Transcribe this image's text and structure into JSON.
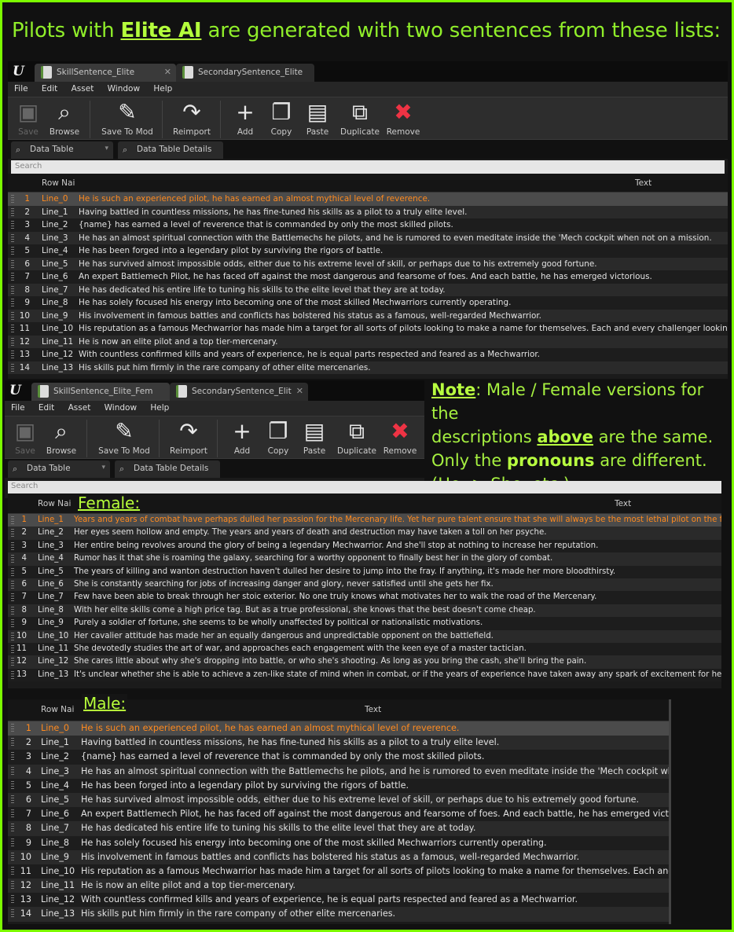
{
  "headline": {
    "pre": "Pilots with ",
    "emph": "Elite AI",
    "post": " are generated with two sentences from these lists:"
  },
  "editor1": {
    "tabs": [
      "SkillSentence_Elite",
      "SecondarySentence_Elite"
    ],
    "menu": [
      "File",
      "Edit",
      "Asset",
      "Window",
      "Help"
    ],
    "tools": [
      "Save",
      "Browse",
      "Save To Mod",
      "Reimport",
      "Add",
      "Copy",
      "Paste",
      "Duplicate",
      "Remove"
    ],
    "panel_tabs": [
      "Data Table",
      "Data Table Details"
    ],
    "search_placeholder": "Search",
    "col_row": "Row Nai",
    "col_text": "Text",
    "rows": [
      {
        "n": "1",
        "name": "Line_0",
        "text": "He is such an experienced pilot, he has earned an almost mythical level of reverence."
      },
      {
        "n": "2",
        "name": "Line_1",
        "text": "Having battled in countless missions, he has fine-tuned his skills as a pilot to a truly elite level."
      },
      {
        "n": "3",
        "name": "Line_2",
        "text": "{name} has earned a level of reverence that is commanded by only the most skilled pilots."
      },
      {
        "n": "4",
        "name": "Line_3",
        "text": "He has an almost spiritual connection with the Battlemechs he pilots, and he is rumored to even meditate inside the 'Mech cockpit when not on a mission."
      },
      {
        "n": "5",
        "name": "Line_4",
        "text": "He has been forged into a legendary pilot by surviving the rigors of battle."
      },
      {
        "n": "6",
        "name": "Line_5",
        "text": "He has survived almost impossible odds, either due to his extreme level of skill, or perhaps due to his extremely good fortune."
      },
      {
        "n": "7",
        "name": "Line_6",
        "text": "An expert Battlemech Pilot, he has faced off against the most dangerous and fearsome of foes. And each battle, he has emerged victorious."
      },
      {
        "n": "8",
        "name": "Line_7",
        "text": "He has dedicated his entire life to tuning his skills to the elite level that they are at today."
      },
      {
        "n": "9",
        "name": "Line_8",
        "text": "He has solely focused his energy into becoming one of the most skilled Mechwarriors currently operating."
      },
      {
        "n": "10",
        "name": "Line_9",
        "text": "His involvement in famous battles and conflicts has bolstered his status as a famous, well-regarded Mechwarrior."
      },
      {
        "n": "11",
        "name": "Line_10",
        "text": "His reputation as a famous Mechwarrior has made him a target for all sorts of pilots looking to make a name for themselves. Each and every challenger looking to take"
      },
      {
        "n": "12",
        "name": "Line_11",
        "text": "He is now an elite pilot and a top tier-mercenary."
      },
      {
        "n": "13",
        "name": "Line_12",
        "text": "With countless confirmed kills and years of experience, he is equal parts respected and feared as a Mechwarrior."
      },
      {
        "n": "14",
        "name": "Line_13",
        "text": "His skills put him firmly in the rare company of other elite mercenaries."
      }
    ]
  },
  "editor2": {
    "tabs": [
      "SkillSentence_Elite_Fem",
      "SecondarySentence_Elit"
    ],
    "menu": [
      "File",
      "Edit",
      "Asset",
      "Window",
      "Help"
    ],
    "tools": [
      "Save",
      "Browse",
      "Save To Mod",
      "Reimport",
      "Add",
      "Copy",
      "Paste",
      "Duplicate",
      "Remove"
    ],
    "panel_tabs": [
      "Data Table",
      "Data Table Details"
    ]
  },
  "note": {
    "label": "Note",
    "line1_rest": ": Male / Female versions for the",
    "line2_pre": "descriptions ",
    "line2_emph": "above",
    "line2_post": " are the same.",
    "line3_pre": "Only the ",
    "line3_emph": "pronouns",
    "line3_post": " are different.",
    "line4": "(He -> She, etc.)"
  },
  "female": {
    "label": "Female:",
    "search_placeholder": "Search",
    "col_row": "Row Nai",
    "col_text": "Text",
    "rows": [
      {
        "n": "1",
        "name": "Line_1",
        "text": "Years and years of combat have perhaps dulled her passion for the Mercenary life. Yet her pure talent ensure that she will always be the most lethal pilot on the field."
      },
      {
        "n": "2",
        "name": "Line_2",
        "text": "Her eyes seem hollow and empty. The years and years of death and destruction may have taken a toll on her psyche."
      },
      {
        "n": "3",
        "name": "Line_3",
        "text": "Her entire being revolves around the glory of being a legendary Mechwarrior. And she'll stop at nothing to increase her reputation."
      },
      {
        "n": "4",
        "name": "Line_4",
        "text": "Rumor has it that she is roaming the galaxy, searching for a worthy opponent to finally best her in the glory of combat."
      },
      {
        "n": "5",
        "name": "Line_5",
        "text": "The years of killing and wanton destruction haven't dulled her desire to jump into the fray. If anything, it's made her more bloodthirsty."
      },
      {
        "n": "6",
        "name": "Line_6",
        "text": "She is constantly searching for jobs of increasing danger and glory, never satisfied until she gets her fix."
      },
      {
        "n": "7",
        "name": "Line_7",
        "text": "Few have been able to break through her stoic exterior. No one truly knows what motivates her to walk the road of the Mercenary."
      },
      {
        "n": "8",
        "name": "Line_8",
        "text": "With her elite skills come a high price tag. But as a true professional, she knows that the best doesn't come cheap."
      },
      {
        "n": "9",
        "name": "Line_9",
        "text": "Purely a soldier of fortune, she seems to be wholly unaffected by political or nationalistic motivations."
      },
      {
        "n": "10",
        "name": "Line_10",
        "text": "Her cavalier attitude has made her an equally dangerous and unpredictable opponent on the battlefield."
      },
      {
        "n": "11",
        "name": "Line_11",
        "text": "She devotedly studies the art of war, and approaches each engagement with the keen eye of a master tactician."
      },
      {
        "n": "12",
        "name": "Line_12",
        "text": "She cares little about why she's dropping into battle, or who she's shooting. As long as you bring the cash, she'll bring the pain."
      },
      {
        "n": "13",
        "name": "Line_13",
        "text": "It's unclear whether she is able to achieve a zen-like state of mind when in combat, or if the years of experience have taken away any spark of excitement for her."
      }
    ]
  },
  "male": {
    "label": "Male:",
    "col_row": "Row Nai",
    "col_text": "Text",
    "rows": [
      {
        "n": "1",
        "name": "Line_0",
        "text": "He is such an experienced pilot, he has earned an almost mythical level of reverence."
      },
      {
        "n": "2",
        "name": "Line_1",
        "text": "Having battled in countless missions, he has fine-tuned his skills as a pilot to a truly elite level."
      },
      {
        "n": "3",
        "name": "Line_2",
        "text": "{name} has earned a level of reverence that is commanded by only the most skilled pilots."
      },
      {
        "n": "4",
        "name": "Line_3",
        "text": "He has an almost spiritual connection with the Battlemechs he pilots, and he is rumored to even meditate inside the 'Mech cockpit whe"
      },
      {
        "n": "5",
        "name": "Line_4",
        "text": "He has been forged into a legendary pilot by surviving the rigors of battle."
      },
      {
        "n": "6",
        "name": "Line_5",
        "text": "He has survived almost impossible odds, either due to his extreme level of skill, or perhaps due to his extremely good fortune."
      },
      {
        "n": "7",
        "name": "Line_6",
        "text": "An expert Battlemech Pilot, he has faced off against the most dangerous and fearsome of foes. And each battle, he has emerged victori"
      },
      {
        "n": "8",
        "name": "Line_7",
        "text": "He has dedicated his entire life to tuning his skills to the elite level that they are at today."
      },
      {
        "n": "9",
        "name": "Line_8",
        "text": "He has solely focused his energy into becoming one of the most skilled Mechwarriors currently operating."
      },
      {
        "n": "10",
        "name": "Line_9",
        "text": "His involvement in famous battles and conflicts has bolstered his status as a famous, well-regarded Mechwarrior."
      },
      {
        "n": "11",
        "name": "Line_10",
        "text": "His reputation as a famous Mechwarrior has made him a target for all sorts of pilots looking to make a name for themselves. Each and e"
      },
      {
        "n": "12",
        "name": "Line_11",
        "text": "He is now an elite pilot and a top tier-mercenary."
      },
      {
        "n": "13",
        "name": "Line_12",
        "text": "With countless confirmed kills and years of experience, he is equal parts respected and feared as a Mechwarrior."
      },
      {
        "n": "14",
        "name": "Line_13",
        "text": "His skills put him firmly in the rare company of other elite mercenaries."
      }
    ]
  },
  "colors": {
    "accent_green": "#7cfc00",
    "selected_row_text": "#ff8a1e",
    "row_alt": "#2a2a2a"
  },
  "icons": {
    "save": "floppy-disk-icon",
    "browse": "magnifier-icon",
    "save_to_mod": "floppy-edit-icon",
    "reimport": "reimport-arrow-icon",
    "add": "plus-icon",
    "copy": "copy-pages-icon",
    "paste": "clipboard-icon",
    "duplicate": "duplicate-icon",
    "remove": "trash-icon"
  }
}
